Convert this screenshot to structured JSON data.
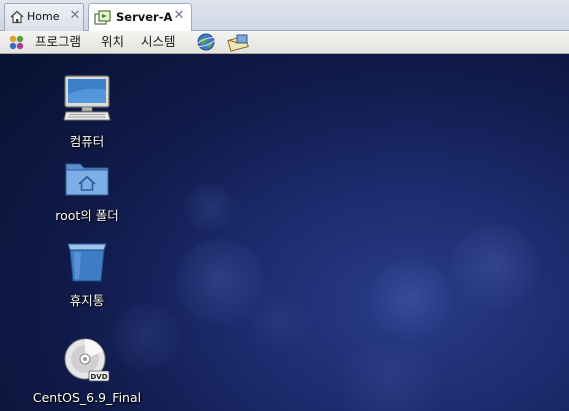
{
  "tabs": [
    {
      "label": "Home",
      "icon": "home-icon",
      "active": false
    },
    {
      "label": "Server-A",
      "icon": "vm-icon",
      "active": true
    }
  ],
  "panel": {
    "menus": {
      "applications": "프로그램",
      "places": "위치",
      "system": "시스템"
    },
    "launchers": [
      "web-browser-icon",
      "mail-client-icon"
    ]
  },
  "desktop": {
    "icons": {
      "computer": {
        "label": "컴퓨터",
        "icon": "computer-icon"
      },
      "home_folder": {
        "label": "root의 폴더",
        "icon": "home-folder-icon"
      },
      "trash": {
        "label": "휴지통",
        "icon": "trash-icon"
      },
      "dvd": {
        "label": "CentOS_6.9_Final",
        "icon": "dvd-icon",
        "badge": "DVD"
      }
    }
  },
  "colors": {
    "desktop_background": "#1b2a6b",
    "panel_background": "#ececea",
    "tab_active": "#ffffff"
  }
}
